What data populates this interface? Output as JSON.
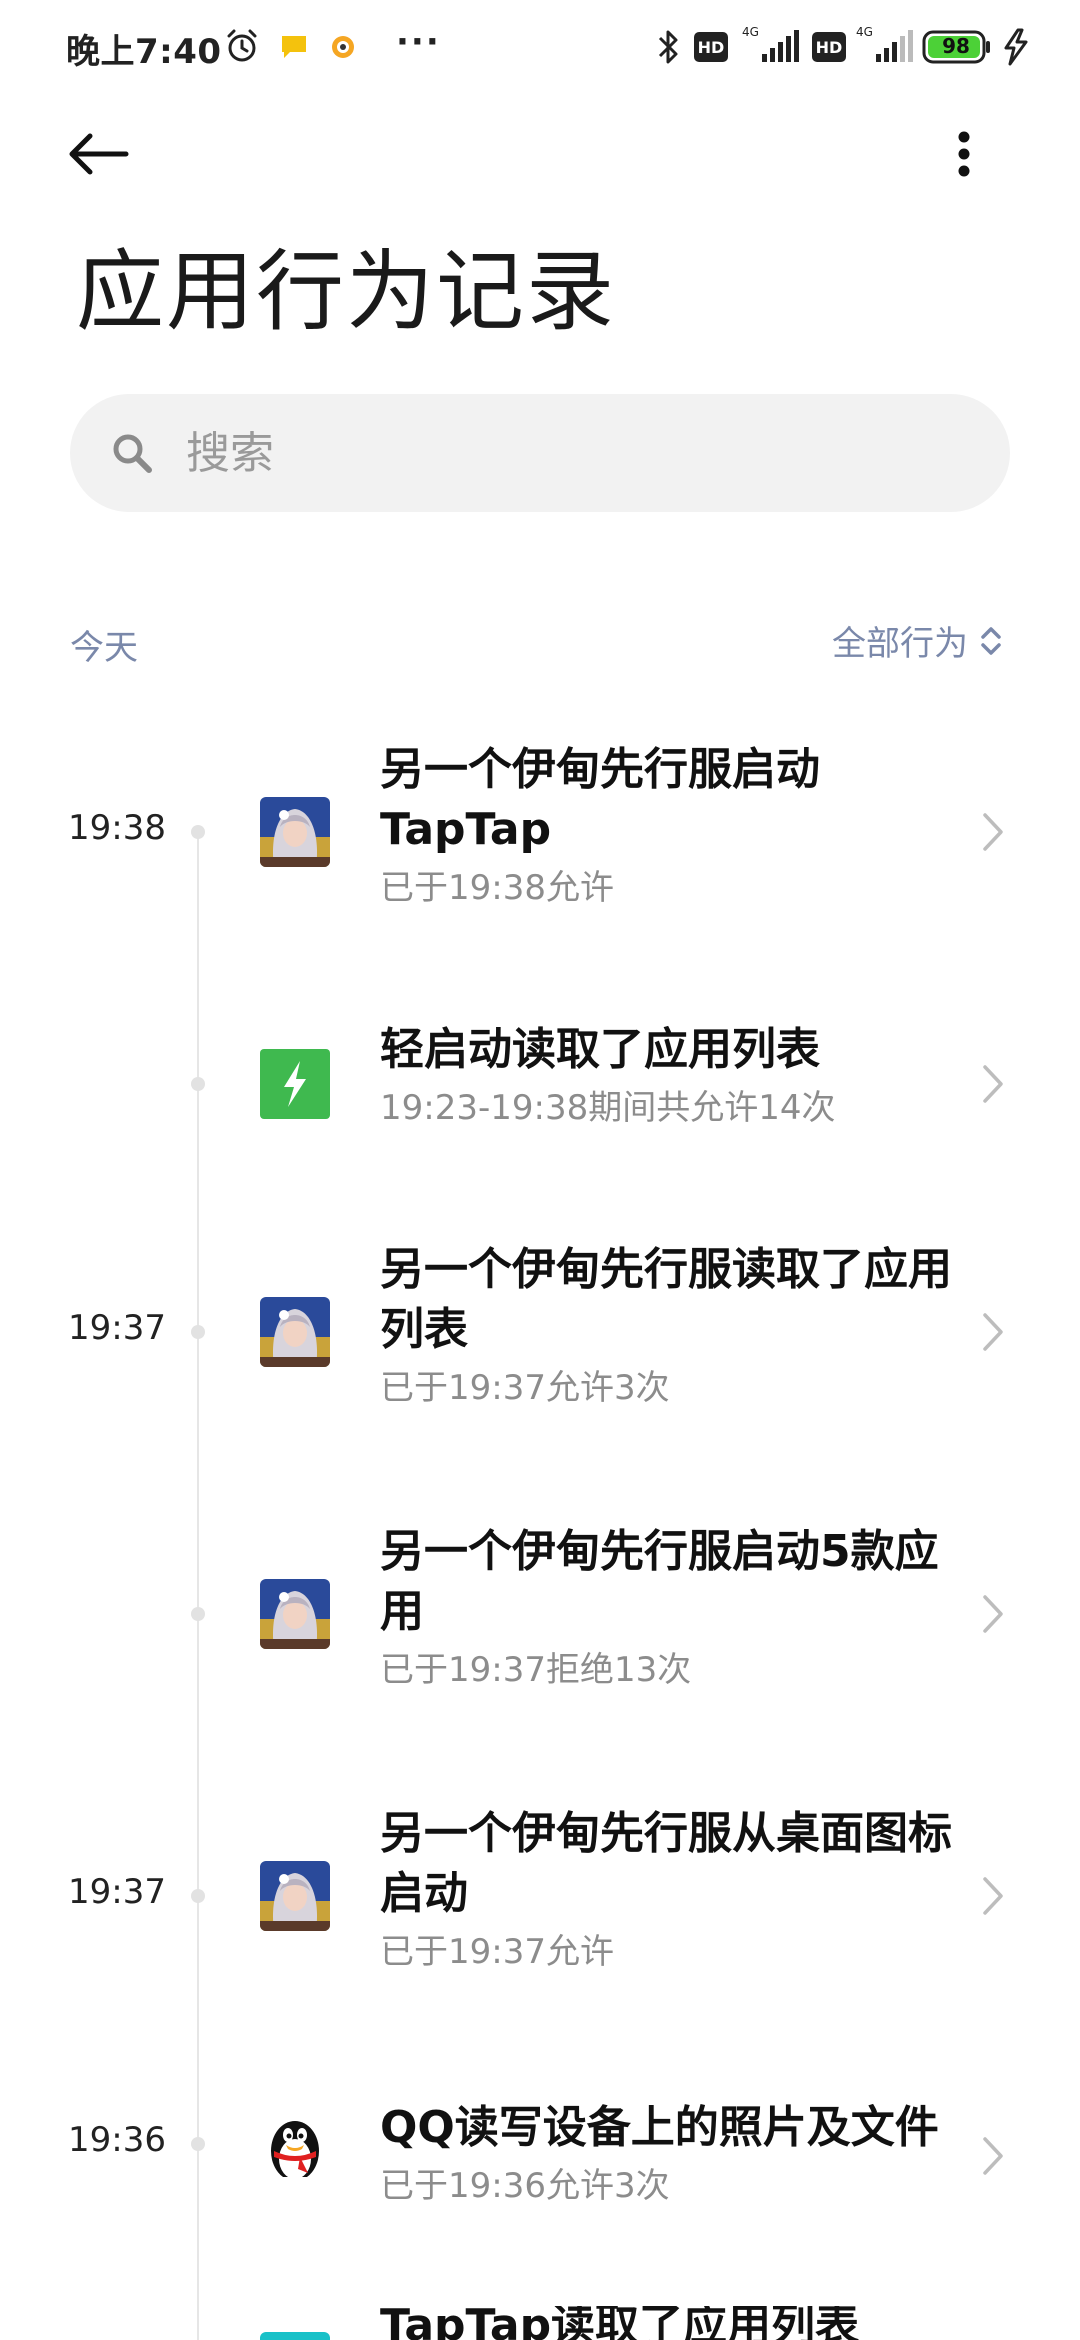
{
  "status_bar": {
    "time": "晚上7:40",
    "more_indicator": "···",
    "battery_level": "98",
    "icons": [
      "alarm-icon",
      "note-app-icon",
      "notification-app-icon",
      "bluetooth-icon",
      "hd-icon",
      "4g-signal-icon",
      "hd-icon",
      "4g-signal-icon",
      "battery-icon",
      "charging-icon"
    ]
  },
  "header": {
    "title": "应用行为记录",
    "back_icon": "back-arrow-icon",
    "more_icon": "more-vert-icon"
  },
  "search": {
    "placeholder": "搜索"
  },
  "filter": {
    "day_label": "今天",
    "filter_label": "全部行为"
  },
  "records": [
    {
      "time": "19:38",
      "app_icon": "game-avatar-icon",
      "title": "另一个伊甸先行服启动TapTap",
      "subtitle": "已于19:38允许"
    },
    {
      "time": "",
      "app_icon": "lightning-app-icon",
      "title": "轻启动读取了应用列表",
      "subtitle": "19:23-19:38期间共允许14次"
    },
    {
      "time": "19:37",
      "app_icon": "game-avatar-icon",
      "title": "另一个伊甸先行服读取了应用列表",
      "subtitle": "已于19:37允许3次"
    },
    {
      "time": "",
      "app_icon": "game-avatar-icon",
      "title": "另一个伊甸先行服启动5款应用",
      "subtitle": "已于19:37拒绝13次"
    },
    {
      "time": "19:37",
      "app_icon": "game-avatar-icon",
      "title": "另一个伊甸先行服从桌面图标启动",
      "subtitle": "已于19:37允许"
    },
    {
      "time": "19:36",
      "app_icon": "qq-penguin-icon",
      "title": "QQ读写设备上的照片及文件",
      "subtitle": "已于19:36允许3次"
    },
    {
      "time": "",
      "app_icon": "taptap-app-icon",
      "title": "TapTap读取了应用列表",
      "subtitle": ""
    }
  ],
  "colors": {
    "accent_text": "#7a88aa",
    "battery_fill": "#4cd137",
    "lightning_app": "#3fb94f",
    "taptap_app": "#19c1c8"
  }
}
